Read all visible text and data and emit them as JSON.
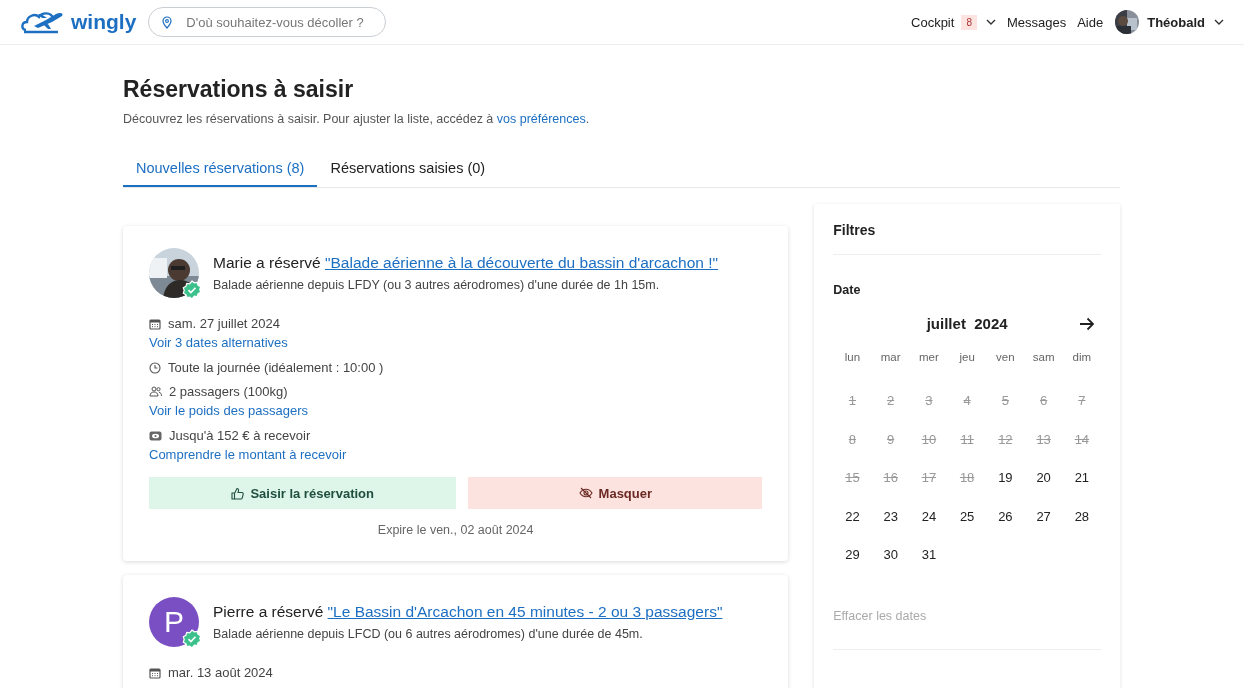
{
  "header": {
    "logo": "wingly",
    "search": {
      "placeholder": "D'où souhaitez-vous décoller ?"
    },
    "nav": [
      {
        "label": "Cockpit",
        "badge": "8",
        "kind": "dropdown"
      },
      {
        "label": "Messages",
        "kind": "link"
      },
      {
        "label": "Aide",
        "kind": "link"
      }
    ],
    "user": {
      "name": "Théobald"
    }
  },
  "page": {
    "title": "Réservations à saisir",
    "intro": "Découvrez les réservations à saisir. Pour ajuster la liste, accédez à ",
    "intro_link": "vos préférences",
    "intro_end": "."
  },
  "tabs": [
    {
      "label": "Nouvelles réservations (8)",
      "selected": true
    },
    {
      "label": "Réservations saisies (0)",
      "selected": false
    }
  ],
  "bookings": [
    {
      "verified": true,
      "who": "Marie a réservé",
      "flight": "\"Balade aérienne à la découverte du bassin d'arcachon !\"",
      "subtitle": "Balade aérienne depuis LFDY (ou 3 autres aérodromes) d'une durée de 1h 15m.",
      "details": [
        {
          "kind": "date",
          "text": "sam. 27 juillet 2024",
          "link": "Voir 3 dates alternatives"
        },
        {
          "kind": "time",
          "text": "Toute la journée (idéalement : 10:00 )"
        },
        {
          "kind": "passengers",
          "text": "2 passagers (100kg)",
          "link": "Voir le poids des passagers"
        },
        {
          "kind": "money",
          "text": "Jusqu'à 152 € à recevoir",
          "link": "Comprendre le montant à recevoir"
        }
      ],
      "accept": "Saisir la réservation",
      "hide": "Masquer",
      "expires": "Expire le ven., 02 août 2024"
    },
    {
      "avatar": {
        "kind": "initial",
        "letter": "P",
        "color": "#7b4fc4"
      },
      "verified": true,
      "who": "Pierre a réservé",
      "flight": "\"Le Bassin d'Arcachon en 45 minutes - 2 ou 3 passagers\"",
      "subtitle": "Balade aérienne depuis LFCD (ou 6 autres aérodromes) d'une durée de 45m.",
      "details": [
        {
          "kind": "date",
          "text": "mar. 13 août 2024"
        }
      ]
    }
  ],
  "filters": {
    "title": "Filtres",
    "date_label": "Date",
    "month": "juillet  2024",
    "weekdays": [
      "lun",
      "mar",
      "mer",
      "jeu",
      "ven",
      "sam",
      "dim"
    ],
    "days": [
      {
        "day": "1",
        "disabled": true
      },
      {
        "day": "2",
        "disabled": true
      },
      {
        "day": "3",
        "disabled": true
      },
      {
        "day": "4",
        "disabled": true
      },
      {
        "day": "5",
        "disabled": true
      },
      {
        "day": "6",
        "disabled": true
      },
      {
        "day": "7",
        "disabled": true
      },
      {
        "day": "8",
        "disabled": true
      },
      {
        "day": "9",
        "disabled": true
      },
      {
        "day": "10",
        "disabled": true
      },
      {
        "day": "11",
        "disabled": true
      },
      {
        "day": "12",
        "disabled": true
      },
      {
        "day": "13",
        "disabled": true
      },
      {
        "day": "14",
        "disabled": true
      },
      {
        "day": "15",
        "disabled": true
      },
      {
        "day": "16",
        "disabled": true
      },
      {
        "day": "17",
        "disabled": true
      },
      {
        "day": "18",
        "disabled": true
      },
      {
        "day": "19",
        "disabled": false
      },
      {
        "day": "20",
        "disabled": false
      },
      {
        "day": "21",
        "disabled": false
      },
      {
        "day": "22",
        "disabled": false
      },
      {
        "day": "23",
        "disabled": false
      },
      {
        "day": "24",
        "disabled": false
      },
      {
        "day": "25",
        "disabled": false
      },
      {
        "day": "26",
        "disabled": false
      },
      {
        "day": "27",
        "disabled": false
      },
      {
        "day": "28",
        "disabled": false
      },
      {
        "day": "29",
        "disabled": false
      },
      {
        "day": "30",
        "disabled": false
      },
      {
        "day": "31",
        "disabled": false
      }
    ],
    "clear": "Effacer les dates"
  }
}
